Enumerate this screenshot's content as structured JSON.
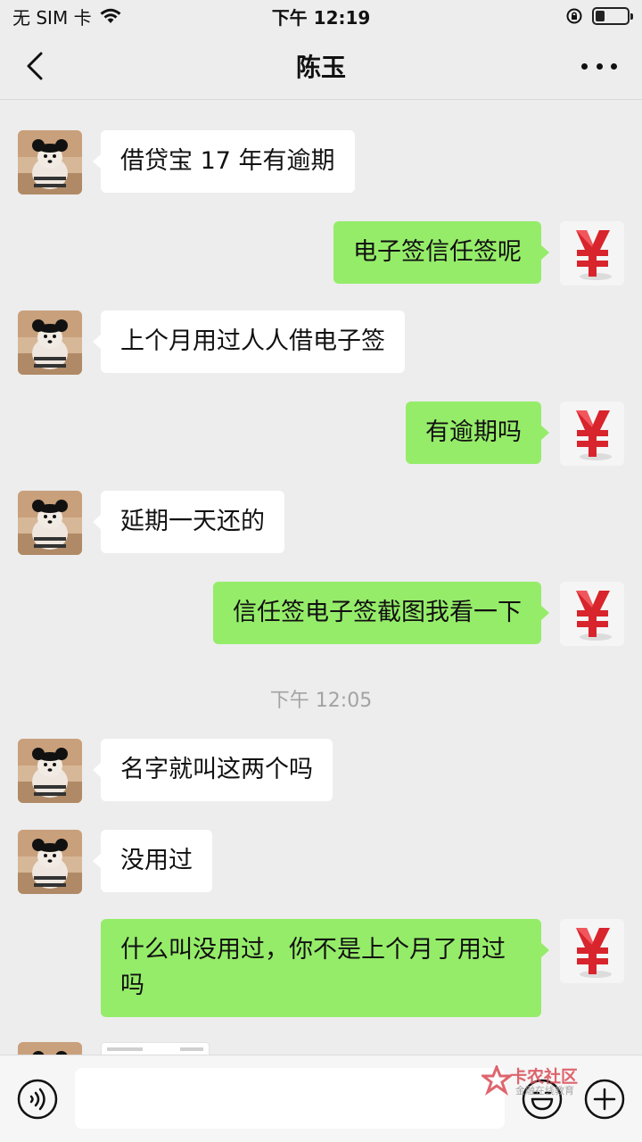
{
  "status_bar": {
    "carrier": "无 SIM 卡",
    "time": "下午 12:19"
  },
  "header": {
    "title": "陈玉"
  },
  "messages": [
    {
      "side": "left",
      "text": "借贷宝 17 年有逾期"
    },
    {
      "side": "right",
      "text": "电子签信任签呢"
    },
    {
      "side": "left",
      "text": "上个月用过人人借电子签"
    },
    {
      "side": "right",
      "text": "有逾期吗"
    },
    {
      "side": "left",
      "text": "延期一天还的"
    },
    {
      "side": "right",
      "text": "信任签电子签截图我看一下"
    },
    {
      "side": "left",
      "text": "名字就叫这两个吗"
    },
    {
      "side": "left",
      "text": "没用过"
    },
    {
      "side": "right",
      "text": "什么叫没用过，你不是上个月了用过吗"
    }
  ],
  "timestamp": "下午 12:05",
  "input": {
    "value": ""
  },
  "watermark": {
    "title": "卡农社区",
    "subtitle": "金融在线教育"
  },
  "colors": {
    "background": "#ededed",
    "sent_bubble": "#95ec69",
    "received_bubble": "#ffffff",
    "yuan_red": "#d8242c"
  },
  "icons": [
    "wifi-icon",
    "rotation-lock-icon",
    "battery-icon",
    "back-icon",
    "more-icon",
    "voice-icon",
    "emoji-icon",
    "plus-icon",
    "yuan-icon"
  ]
}
